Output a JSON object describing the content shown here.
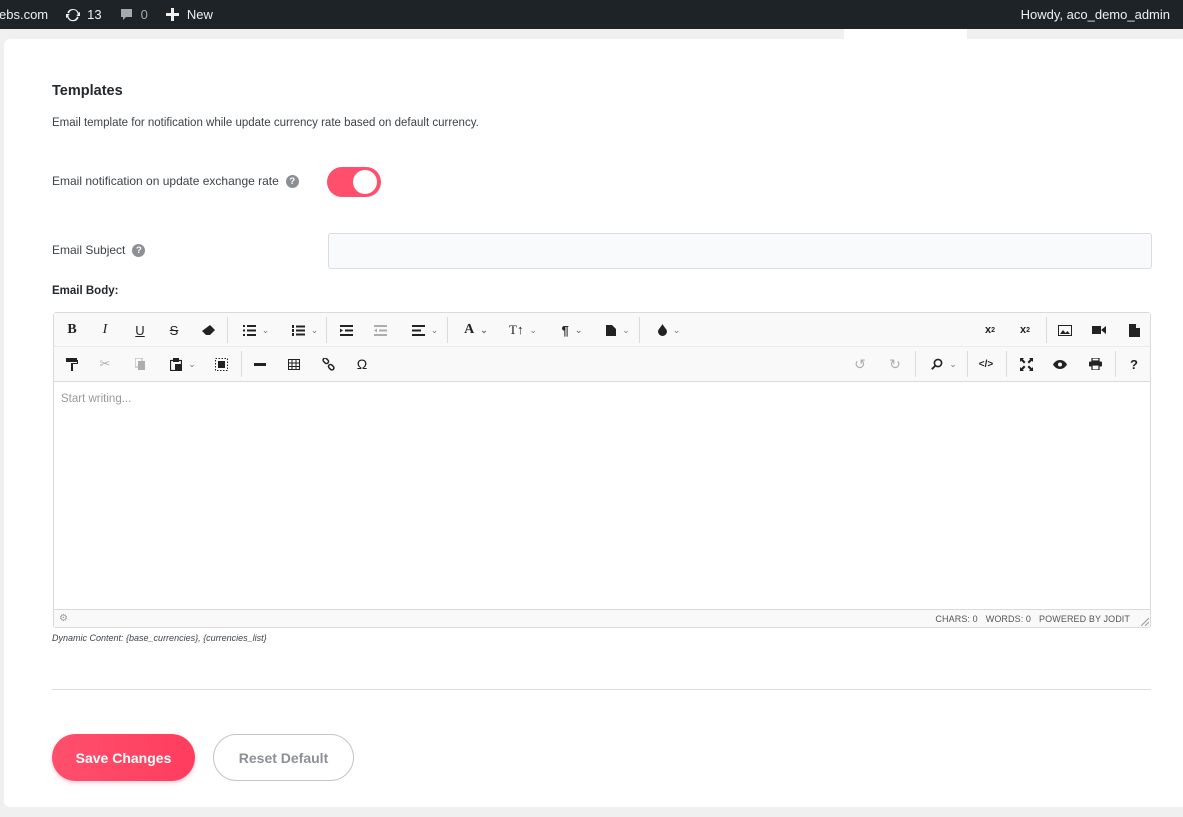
{
  "adminbar": {
    "site_label": "ebs.com",
    "updates_count": "13",
    "comments_count": "0",
    "new_label": "New",
    "howdy_label": "Howdy, aco_demo_admin"
  },
  "section": {
    "title": "Templates",
    "description": "Email template for notification while update currency rate based on default currency."
  },
  "fields": {
    "notify_label": "Email notification on update exchange rate",
    "notify_enabled": true,
    "subject_label": "Email Subject",
    "subject_value": "",
    "body_label": "Email Body:"
  },
  "editor": {
    "placeholder": "Start writing...",
    "chars_label": "CHARS: 0",
    "words_label": "WORDS: 0",
    "powered_label": "POWERED BY JODIT",
    "toolbar_row1": [
      "bold",
      "italic",
      "underline",
      "strikethrough",
      "eraser",
      "ul",
      "ol",
      "indent",
      "outdent",
      "align",
      "font",
      "font-size",
      "paragraph",
      "classes",
      "brush",
      "superscript",
      "subscript",
      "image",
      "video",
      "file"
    ],
    "toolbar_row2": [
      "copyformat",
      "cut",
      "copy",
      "paste",
      "select-all",
      "hr",
      "table",
      "link",
      "symbols",
      "undo",
      "redo",
      "find",
      "source",
      "fullsize",
      "preview",
      "print",
      "about"
    ]
  },
  "dynamic_content": "Dynamic Content: {base_currencies}, {currencies_list}",
  "buttons": {
    "save_label": "Save Changes",
    "reset_label": "Reset Default"
  },
  "colors": {
    "accent": "#ff4f6d",
    "adminbar_bg": "#1d2327"
  }
}
